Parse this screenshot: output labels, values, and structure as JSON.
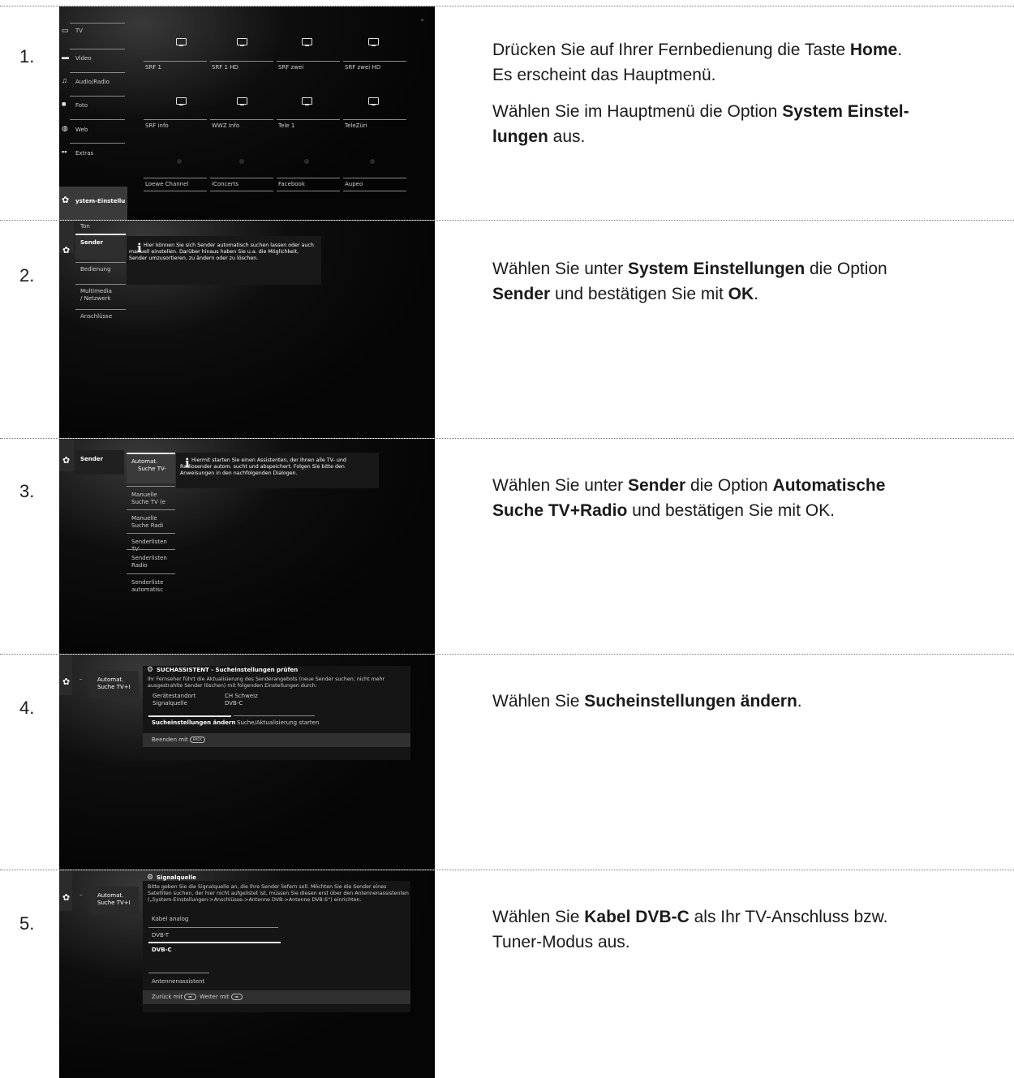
{
  "steps": [
    {
      "number": "1.",
      "text": [
        [
          "Drücken Sie auf Ihrer Fernbedienung die Taste ",
          "Home",
          ".",
          "",
          "",
          "",
          ""
        ],
        [
          "Es erscheint das Hauptmenü.",
          "",
          "",
          "",
          "",
          "",
          ""
        ]
      ],
      "para2": [
        "Wählen Sie im Hauptmenü die Option ",
        "System Einstel-lungen",
        " aus."
      ],
      "screen": {
        "menu": [
          "TV",
          "Video",
          "Audio/Radio",
          "Foto",
          "Web",
          "Extras"
        ],
        "menu_selected": "ystem-Einstellu",
        "channels_row1": [
          "SRF 1",
          "SRF 1 HD",
          "SRF zwei",
          "SRF zwei HD"
        ],
        "channels_row2": [
          "SRF info",
          "WWZ Info",
          "Tele 1",
          "TeleZüri"
        ],
        "channels_row3": [
          "Loewe Channel",
          "iConcerts",
          "Facebook",
          "Aupeo"
        ]
      }
    },
    {
      "number": "2.",
      "text_parts": [
        "Wählen Sie unter ",
        "System Einstellungen",
        " die Option ",
        "Sender",
        " und bestätigen Sie mit ",
        "OK",
        "."
      ],
      "screen": {
        "menu_top": "Ton",
        "menu": [
          "Sender",
          "Bedienung",
          "Multimedia / Netzwerk",
          "Anschlüsse"
        ],
        "info_text": "Hier können Sie sich Sender automatisch suchen lassen oder auch manuell einstellen. Darüber hinaus haben Sie u.a. die Möglichkeit, Sender umzusortieren, zu ändern oder zu löschen."
      }
    },
    {
      "number": "3.",
      "text_parts": [
        "Wählen Sie unter ",
        "Sender",
        " die Option ",
        "Automatische Suche TV+Radio",
        " und bestätigen Sie mit OK."
      ],
      "screen": {
        "left_item": "Sender",
        "menu": [
          "Automat. Suche TV-",
          "Manuelle Suche TV (e",
          "Manuelle Suche Radi",
          "Senderlisten TV",
          "Senderlisten Radio",
          "Senderliste automatisc"
        ],
        "info_text": "Hiermit starten Sie einen Assistenten, der Ihnen alle TV- und Radiosender autom. sucht und abspeichert. Folgen Sie bitte den Anweisungen in den nachfolgenden Dialogen."
      }
    },
    {
      "number": "4.",
      "text_parts": [
        "Wählen Sie ",
        "Sucheinstellungen ändern",
        "."
      ],
      "screen": {
        "left_item": "Automat. Suche TV+I",
        "dialog_title": "SUCHASSISTENT - Sucheinstellungen prüfen",
        "dialog_text": "Ihr Fernseher führt die Aktualisierung des Senderangebots (neue Sender suchen; nicht mehr ausgestrahlte Sender löschen) mit folgenden Einstellungen durch:",
        "rows": [
          [
            "Gerätestandort",
            "CH Schweiz"
          ],
          [
            "Signalquelle",
            "DVB-C"
          ]
        ],
        "btn_change": "Sucheinstellungen ändern",
        "btn_start": "Suche/Aktualisierung starten",
        "footer": "Beenden mit",
        "footer_key": "BACK"
      }
    },
    {
      "number": "5.",
      "text_parts": [
        "Wählen Sie ",
        "Kabel DVB-C",
        " als Ihr TV-Anschluss bzw. Tuner-Modus aus."
      ],
      "screen": {
        "left_item": "Automat. Suche TV+I",
        "dialog_title": "Signalquelle",
        "dialog_text": "Bitte geben Sie die Signalquelle an, die Ihre Sender liefern soll. Möchten Sie die Sender eines Satelliten suchen, der hier nicht aufgelistet ist, müssen Sie diesen erst über den Antennenassistenten („System-Einstellungen->Anschlüsse->Antenne DVB->Antenne DVB-S“) einrichten.",
        "options": [
          "Kabel analog",
          "DVB-T",
          "DVB-C"
        ],
        "assistant": "Antennenassistent",
        "footer_back": "Zurück mit",
        "footer_next": "Weiter mit",
        "footer_key": "◄►"
      }
    }
  ]
}
